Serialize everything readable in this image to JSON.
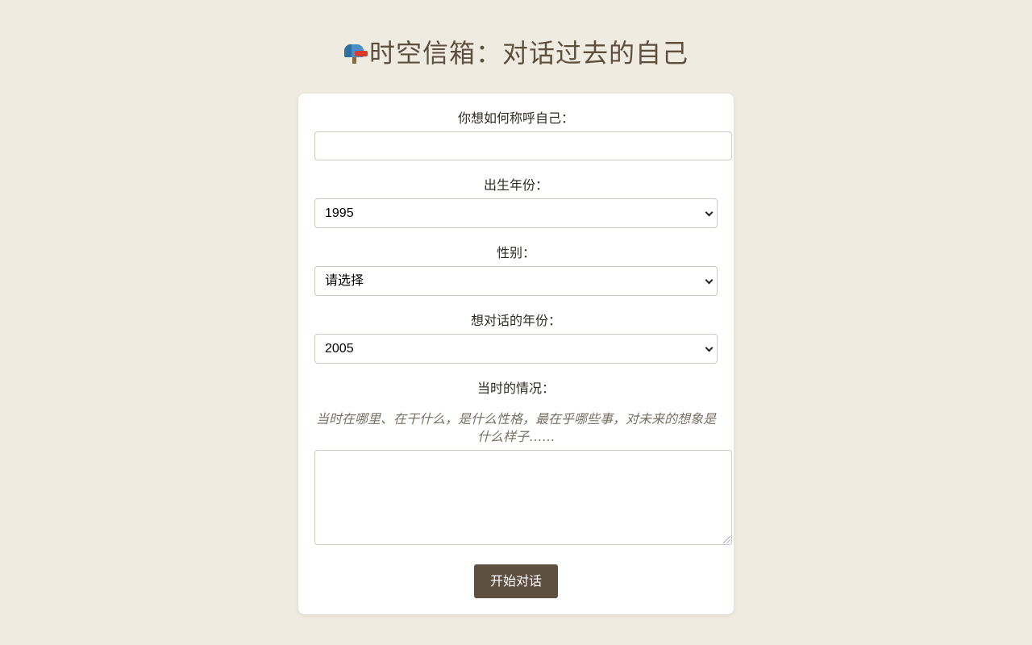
{
  "header": {
    "icon": "mailbox-icon",
    "title": "时空信箱：对话过去的自己"
  },
  "form": {
    "name_label": "你想如何称呼自己：",
    "name_value": "",
    "birth_year_label": "出生年份：",
    "birth_year_value": "1995",
    "gender_label": "性别：",
    "gender_value": "请选择",
    "target_year_label": "想对话的年份：",
    "target_year_value": "2005",
    "situation_label": "当时的情况：",
    "situation_hint": "当时在哪里、在干什么，是什么性格，最在乎哪些事，对未来的想象是什么样子……",
    "situation_value": "",
    "submit_label": "开始对话"
  },
  "colors": {
    "background": "#f0ebe1",
    "card": "#ffffff",
    "title": "#5c4f3e",
    "button": "#5e5040"
  }
}
